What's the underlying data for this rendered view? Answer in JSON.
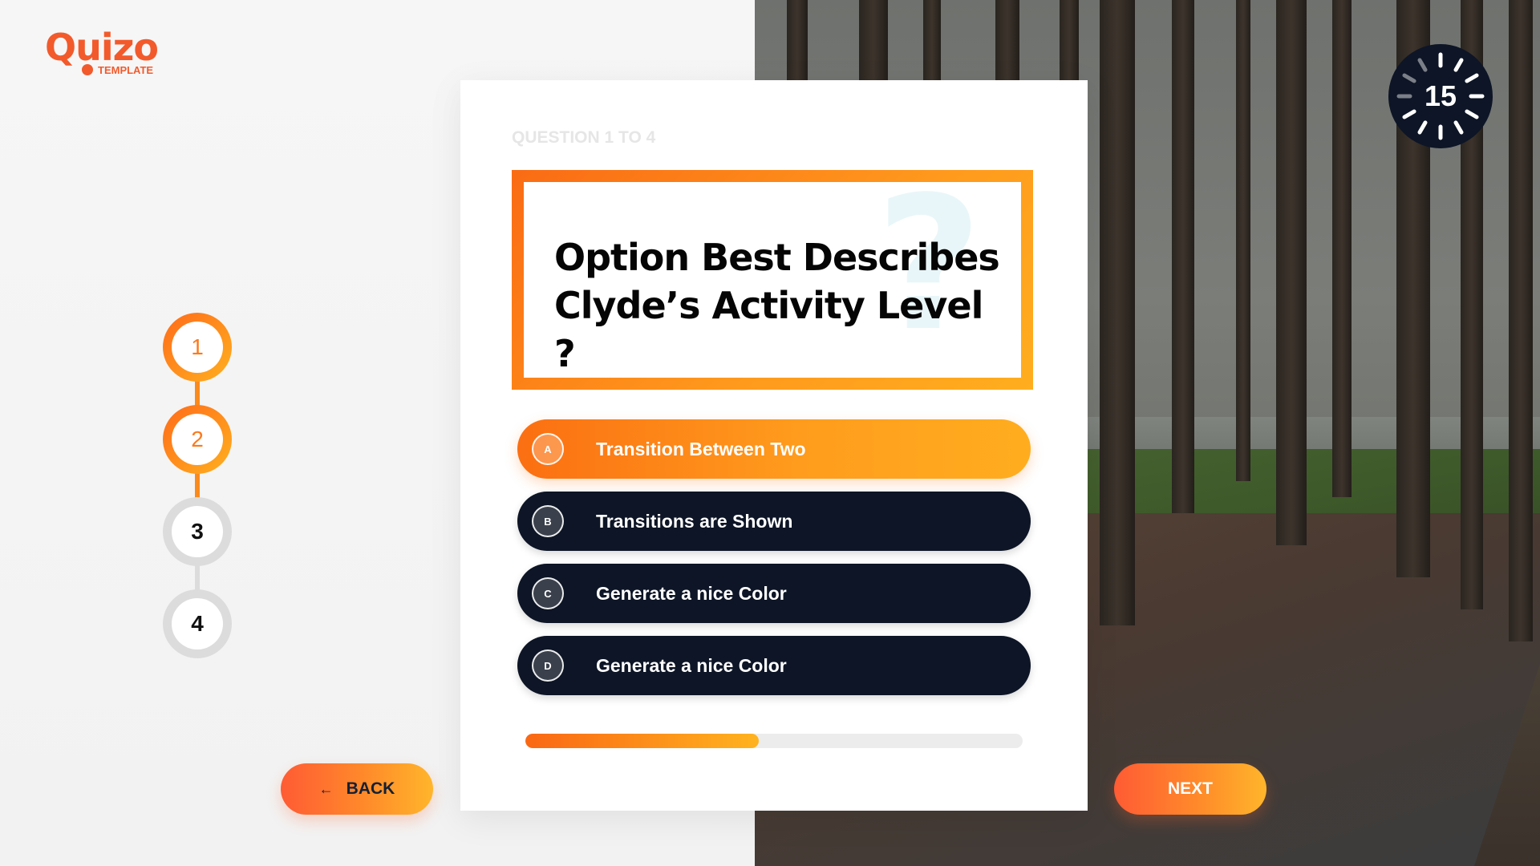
{
  "app": {
    "logo_text": "uizo",
    "logo_q": "Q",
    "logo_sub": "TEMPLATE",
    "brand_color": "#f25a2c"
  },
  "steps": [
    {
      "label": "1",
      "state": "done"
    },
    {
      "label": "2",
      "state": "done"
    },
    {
      "label": "3",
      "state": "todo"
    },
    {
      "label": "4",
      "state": "todo"
    }
  ],
  "question": {
    "counter": "QUESTION 1 TO 4",
    "text": "Option Best Describes Clyde’s Activity Level ?",
    "decor": "?"
  },
  "options": [
    {
      "letter": "A",
      "label": "Transition Between Two",
      "selected": true
    },
    {
      "letter": "B",
      "label": "Transitions are Shown",
      "selected": false
    },
    {
      "letter": "C",
      "label": "Generate a nice Color",
      "selected": false
    },
    {
      "letter": "D",
      "label": "Generate a nice Color",
      "selected": false
    }
  ],
  "progress": {
    "fraction": 0.47
  },
  "nav": {
    "back_label": "BACK",
    "next_label": "NEXT",
    "back_icon": "arrow-left-icon"
  },
  "timer": {
    "value": "15",
    "icon": "spinner-icon"
  },
  "colors": {
    "accent_start": "#fb6f12",
    "accent_end": "#ffad1f",
    "dark": "#0d1526",
    "inactive_step": "#dcdcdc"
  }
}
